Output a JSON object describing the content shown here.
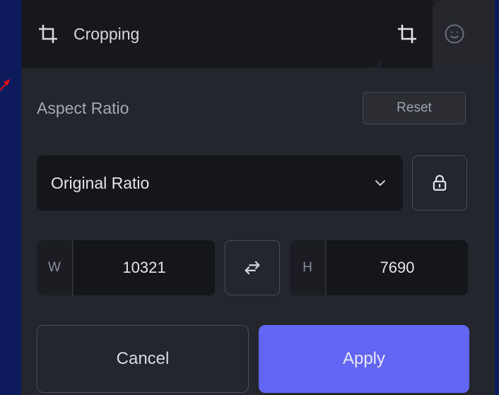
{
  "header": {
    "title": "Cropping",
    "icon": "crop-icon"
  },
  "tabs": [
    {
      "icon": "crop-icon",
      "active": true
    },
    {
      "icon": "sticker-icon",
      "active": false
    }
  ],
  "aspect_ratio": {
    "label": "Aspect Ratio",
    "reset_label": "Reset",
    "selected": "Original Ratio",
    "lock_icon": "lock-icon"
  },
  "dimensions": {
    "width_label": "W",
    "width_value": "10321",
    "height_label": "H",
    "height_value": "7690",
    "swap_icon": "swap-icon"
  },
  "actions": {
    "cancel_label": "Cancel",
    "apply_label": "Apply"
  },
  "colors": {
    "background": "#0d1a5c",
    "panel": "#24262d",
    "accent": "#6366f5",
    "pointer_arrow": "#e01010"
  }
}
